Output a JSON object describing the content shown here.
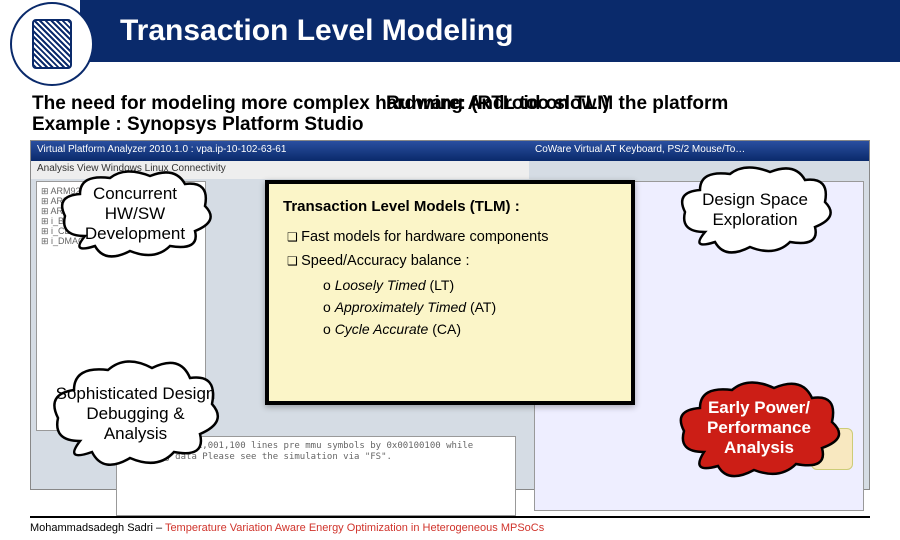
{
  "header": {
    "title": "Transaction Level Modeling"
  },
  "intro": {
    "line1": "The need for modeling more complex hardware: (RTL too slow!)",
    "line1b": "Running Android on TLM the platform",
    "line2": "Example : Synopsys Platform Studio"
  },
  "bg": {
    "titlebar_left": "Virtual Platform Analyzer 2010.1.0 : vpa.ip-10-102-63-61",
    "titlebar_right": "CoWare Virtual AT Keyboard, PS/2 Mouse/To…",
    "menubar": "Analysis  View  Windows   Linux  Connectivity",
    "tree_lines": "⊞ ARM926E…\n⊞ ARM926E…\n⊞ ARM926E…\n⊞ i_BATTERY\n⊞ i_CLCD…\n⊞ i_DMAC_PL0…",
    "console": "compressed                     60x1,001,100\nlines pre mmu symbols by 0x00100100\nwhile preparing data\nPlease see the simulation via \"FS\"."
  },
  "tlm": {
    "title": "Transaction Level Models (TLM) :",
    "b1": "Fast models for hardware components",
    "b2": "Speed/Accuracy balance :",
    "s1": "Loosely Timed",
    "s1p": "(LT)",
    "s2": "Approximately Timed",
    "s2p": "(AT)",
    "s3": "Cycle Accurate",
    "s3p": "(CA)"
  },
  "clouds": {
    "c1": "Concurrent HW/SW Development",
    "c2": "Design Space Exploration",
    "c3": "Sophisticated Design Debugging & Analysis",
    "c4": "Early Power/ Performance Analysis"
  },
  "footer": {
    "author": "Mohammadsadegh Sadri – ",
    "topic": "Temperature Variation Aware Energy Optimization in Heterogeneous MPSoCs"
  }
}
